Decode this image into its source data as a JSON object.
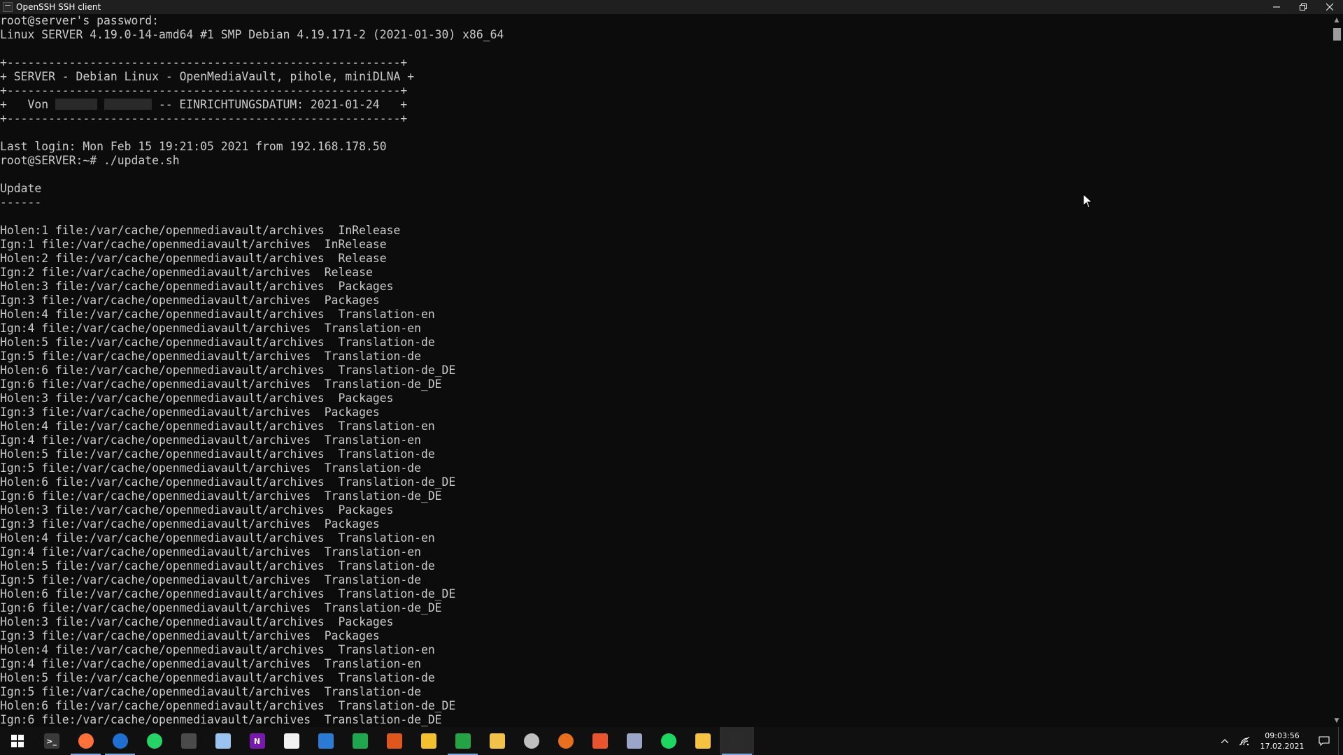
{
  "window": {
    "title": "OpenSSH SSH client",
    "controls": {
      "minimize": "minimize",
      "restore": "restore",
      "close": "close"
    }
  },
  "terminal": {
    "lines": [
      "root@server's password:",
      "Linux SERVER 4.19.0-14-amd64 #1 SMP Debian 4.19.171-2 (2021-01-30) x86_64",
      "",
      "+---------------------------------------------------------+",
      "+ SERVER - Debian Linux - OpenMediaVault, pihole, miniDLNA +",
      "+---------------------------------------------------------+",
      "__BANNER_VON__",
      "+---------------------------------------------------------+",
      "",
      "Last login: Mon Feb 15 19:21:05 2021 from 192.168.178.50",
      "root@SERVER:~# ./update.sh",
      "",
      "Update",
      "------",
      "",
      "Holen:1 file:/var/cache/openmediavault/archives  InRelease",
      "Ign:1 file:/var/cache/openmediavault/archives  InRelease",
      "Holen:2 file:/var/cache/openmediavault/archives  Release",
      "Ign:2 file:/var/cache/openmediavault/archives  Release",
      "Holen:3 file:/var/cache/openmediavault/archives  Packages",
      "Ign:3 file:/var/cache/openmediavault/archives  Packages",
      "Holen:4 file:/var/cache/openmediavault/archives  Translation-en",
      "Ign:4 file:/var/cache/openmediavault/archives  Translation-en",
      "Holen:5 file:/var/cache/openmediavault/archives  Translation-de",
      "Ign:5 file:/var/cache/openmediavault/archives  Translation-de",
      "Holen:6 file:/var/cache/openmediavault/archives  Translation-de_DE",
      "Ign:6 file:/var/cache/openmediavault/archives  Translation-de_DE",
      "Holen:3 file:/var/cache/openmediavault/archives  Packages",
      "Ign:3 file:/var/cache/openmediavault/archives  Packages",
      "Holen:4 file:/var/cache/openmediavault/archives  Translation-en",
      "Ign:4 file:/var/cache/openmediavault/archives  Translation-en",
      "Holen:5 file:/var/cache/openmediavault/archives  Translation-de",
      "Ign:5 file:/var/cache/openmediavault/archives  Translation-de",
      "Holen:6 file:/var/cache/openmediavault/archives  Translation-de_DE",
      "Ign:6 file:/var/cache/openmediavault/archives  Translation-de_DE",
      "Holen:3 file:/var/cache/openmediavault/archives  Packages",
      "Ign:3 file:/var/cache/openmediavault/archives  Packages",
      "Holen:4 file:/var/cache/openmediavault/archives  Translation-en",
      "Ign:4 file:/var/cache/openmediavault/archives  Translation-en",
      "Holen:5 file:/var/cache/openmediavault/archives  Translation-de",
      "Ign:5 file:/var/cache/openmediavault/archives  Translation-de",
      "Holen:6 file:/var/cache/openmediavault/archives  Translation-de_DE",
      "Ign:6 file:/var/cache/openmediavault/archives  Translation-de_DE",
      "Holen:3 file:/var/cache/openmediavault/archives  Packages",
      "Ign:3 file:/var/cache/openmediavault/archives  Packages",
      "Holen:4 file:/var/cache/openmediavault/archives  Translation-en",
      "Ign:4 file:/var/cache/openmediavault/archives  Translation-en",
      "Holen:5 file:/var/cache/openmediavault/archives  Translation-de",
      "Ign:5 file:/var/cache/openmediavault/archives  Translation-de",
      "Holen:6 file:/var/cache/openmediavault/archives  Translation-de_DE",
      "Ign:6 file:/var/cache/openmediavault/archives  Translation-de_DE"
    ],
    "banner_von": {
      "prefix": "+   Von ",
      "suffix": " -- EINRICHTUNGSDATUM: 2021-01-24   +"
    }
  },
  "taskbar": {
    "items": [
      {
        "name": "start-icon",
        "glyph": "",
        "color": "#ffffff",
        "running": false
      },
      {
        "name": "terminal-icon",
        "glyph": ">_",
        "color": "#3a3a3a",
        "running": false
      },
      {
        "name": "firefox-icon",
        "glyph": "",
        "color": "#ff7139",
        "running": true
      },
      {
        "name": "thunderbird-icon",
        "glyph": "",
        "color": "#1f6fd1",
        "running": true
      },
      {
        "name": "whatsapp-icon",
        "glyph": "",
        "color": "#25d366",
        "running": false
      },
      {
        "name": "app-icon",
        "glyph": "",
        "color": "#4a4a4a",
        "running": false
      },
      {
        "name": "notepad-icon",
        "glyph": "",
        "color": "#9ac4ef",
        "running": false
      },
      {
        "name": "onenote-icon",
        "glyph": "N",
        "color": "#7719aa",
        "running": false
      },
      {
        "name": "document-icon",
        "glyph": "",
        "color": "#f2f2f2",
        "running": false
      },
      {
        "name": "writer-icon",
        "glyph": "",
        "color": "#2a7cd3",
        "running": false
      },
      {
        "name": "calc-icon",
        "glyph": "",
        "color": "#1ea54d",
        "running": false
      },
      {
        "name": "impress-icon",
        "glyph": "",
        "color": "#e0571d",
        "running": false
      },
      {
        "name": "draw-icon",
        "glyph": "",
        "color": "#f3c12f",
        "running": false
      },
      {
        "name": "chart-icon",
        "glyph": "",
        "color": "#25a244",
        "running": true
      },
      {
        "name": "pen-icon",
        "glyph": "",
        "color": "#f2c14a",
        "running": false
      },
      {
        "name": "shield-icon",
        "glyph": "",
        "color": "#bfbfbf",
        "running": false
      },
      {
        "name": "vpn-icon",
        "glyph": "",
        "color": "#e76f1d",
        "running": false
      },
      {
        "name": "checkmark-icon",
        "glyph": "",
        "color": "#e8542e",
        "running": false
      },
      {
        "name": "tools-icon",
        "glyph": "",
        "color": "#9aa5c8",
        "running": false
      },
      {
        "name": "spotify-icon",
        "glyph": "",
        "color": "#1ed760",
        "running": false
      },
      {
        "name": "folder-icon",
        "glyph": "",
        "color": "#f5c242",
        "running": false
      },
      {
        "name": "ssh-client-icon",
        "glyph": "",
        "color": "#2b2b2b",
        "running": true,
        "active": true
      }
    ],
    "clock": {
      "time": "09:03:56",
      "date": "17.02.2021"
    }
  }
}
